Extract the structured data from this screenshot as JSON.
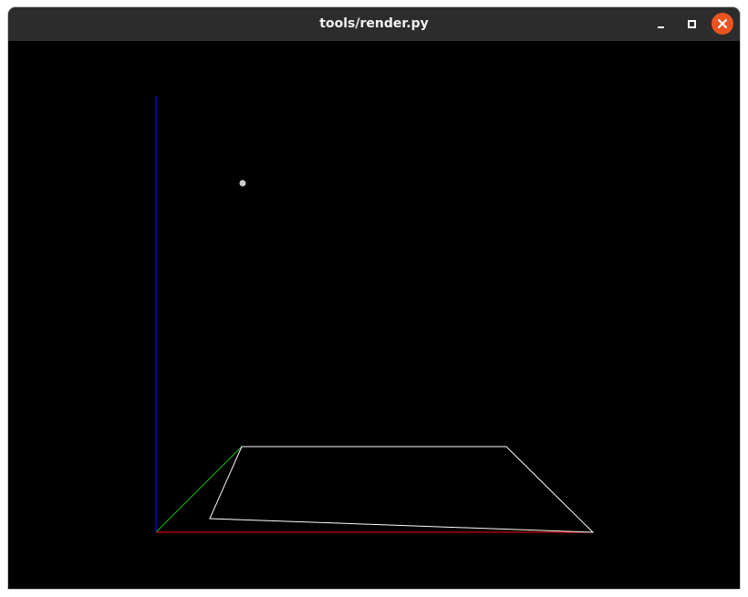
{
  "window": {
    "title": "tools/render.py"
  },
  "controls": {
    "minimize_icon": "minimize-icon",
    "maximize_icon": "maximize-icon",
    "close_icon": "close-icon",
    "close_color": "#e95420"
  },
  "scene": {
    "background": "#000000",
    "axis_colors": {
      "x": "#ff0000",
      "y": "#00c800",
      "z": "#0000ff"
    },
    "outline_color": "#ffffff",
    "point_color": "#cccccc"
  }
}
